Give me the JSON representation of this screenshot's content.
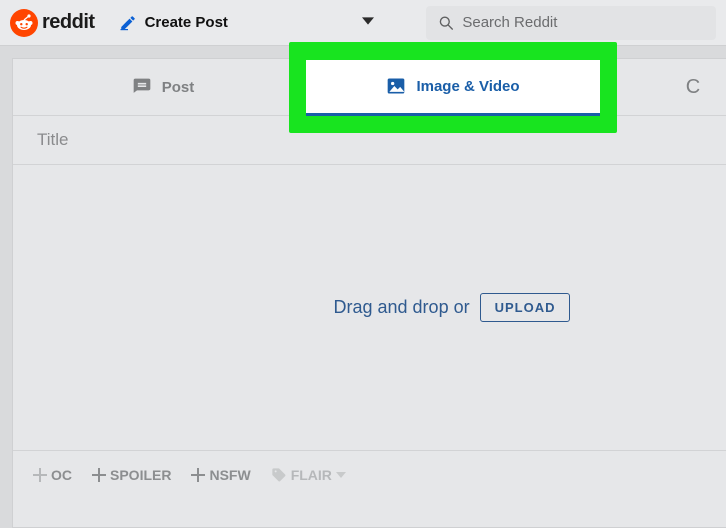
{
  "header": {
    "wordmark": "reddit",
    "create_label": "Create Post",
    "search_placeholder": "Search Reddit"
  },
  "tabs": {
    "post": "Post",
    "image_video": "Image & Video",
    "link_glyph": "C"
  },
  "form": {
    "title_placeholder": "Title",
    "dropzone_text": "Drag and drop or",
    "upload_label": "UPLOAD"
  },
  "flags": {
    "oc": "OC",
    "spoiler": "SPOILER",
    "nsfw": "NSFW",
    "flair": "FLAIR"
  }
}
